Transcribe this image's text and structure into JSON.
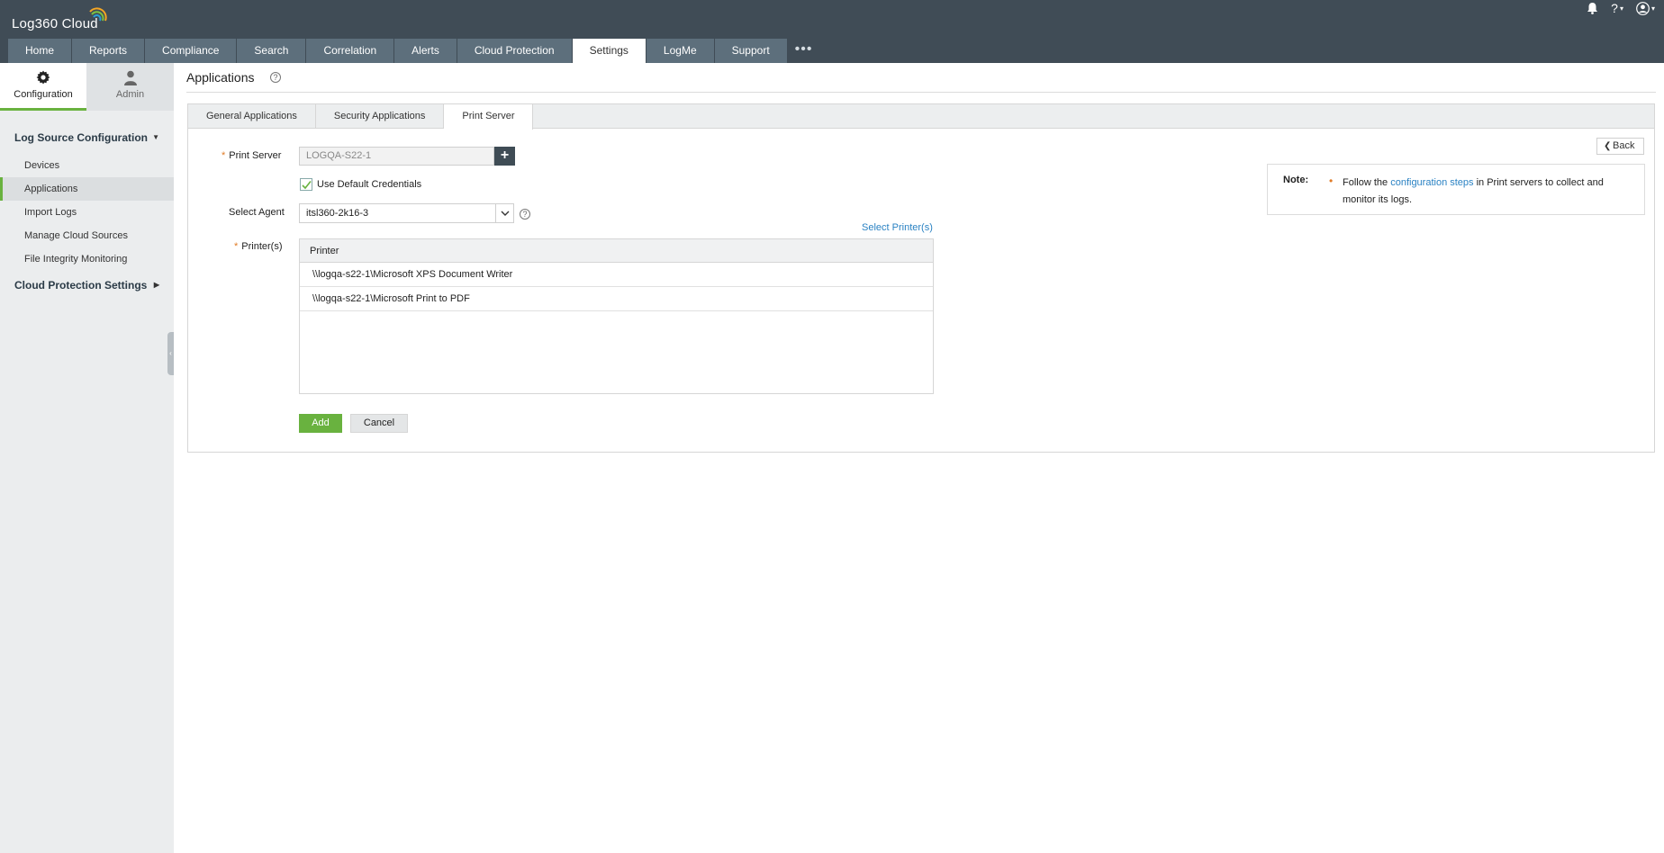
{
  "app": {
    "title": "Log360 Cloud",
    "help_label": "?"
  },
  "nav": {
    "tabs": [
      "Home",
      "Reports",
      "Compliance",
      "Search",
      "Correlation",
      "Alerts",
      "Cloud Protection",
      "Settings",
      "LogMe",
      "Support"
    ],
    "active_tab": "Settings",
    "more_label": "•••"
  },
  "sidebar": {
    "tabs": [
      {
        "label": "Configuration",
        "icon": "gear-icon",
        "active": true
      },
      {
        "label": "Admin",
        "icon": "user-icon",
        "active": false
      }
    ],
    "groups": [
      {
        "label": "Log Source Configuration",
        "expanded": true,
        "items": [
          "Devices",
          "Applications",
          "Import Logs",
          "Manage Cloud Sources",
          "File Integrity Monitoring"
        ],
        "active_item": "Applications"
      },
      {
        "label": "Cloud Protection Settings",
        "expanded": false,
        "items": []
      }
    ]
  },
  "page": {
    "title": "Applications",
    "help_label": "?"
  },
  "subtabs": {
    "items": [
      "General Applications",
      "Security Applications",
      "Print Server"
    ],
    "active": "Print Server"
  },
  "form": {
    "print_server_label": "Print Server",
    "print_server_value": "LOGQA-S22-1",
    "add_server_label": "+",
    "use_default_credentials_label": "Use Default Credentials",
    "use_default_credentials_checked": true,
    "select_agent_label": "Select Agent",
    "select_agent_value": "itsl360-2k16-3",
    "select_printers_link": "Select Printer(s)",
    "printers_label": "Printer(s)",
    "required_mark": "*",
    "printer_table": {
      "header": "Printer",
      "rows": [
        "\\\\logqa-s22-1\\Microsoft XPS Document Writer",
        "\\\\logqa-s22-1\\Microsoft Print to PDF"
      ]
    },
    "add_button": "Add",
    "cancel_button": "Cancel"
  },
  "back_button": "Back",
  "note": {
    "label": "Note:",
    "bullet": "•",
    "text_before": "Follow the ",
    "link_text": "configuration steps",
    "text_after": " in Print servers to collect and monitor its logs."
  },
  "colors": {
    "header_bg": "#404c56",
    "nav_tab_bg": "#5d6f7c",
    "accent_green": "#69b23f",
    "link_blue": "#2a82c3",
    "required_orange": "#e07b27"
  }
}
